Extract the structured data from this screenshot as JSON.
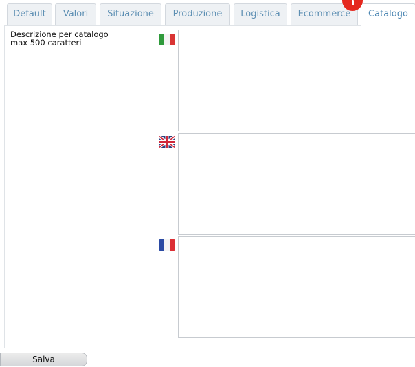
{
  "tabs": [
    {
      "label": "Default",
      "active": false
    },
    {
      "label": "Valori",
      "active": false
    },
    {
      "label": "Situazione",
      "active": false
    },
    {
      "label": "Produzione",
      "active": false
    },
    {
      "label": "Logistica",
      "active": false
    },
    {
      "label": "Ecommerce",
      "active": false
    },
    {
      "label": "Catalogo",
      "active": true
    }
  ],
  "notification_badge_color": "#e5281e",
  "catalog": {
    "description_line1": "Descrizione per catalogo",
    "description_line2": "max 500 caratteri",
    "languages": [
      {
        "flag_icon": "italy-flag-icon",
        "value": ""
      },
      {
        "flag_icon": "uk-flag-icon",
        "value": ""
      },
      {
        "flag_icon": "france-flag-icon",
        "value": ""
      }
    ]
  },
  "save_label": "Salva",
  "colors": {
    "tab_text": "#5d8fb3",
    "tab_bg": "#eef1f4",
    "border": "#c7cbd0"
  }
}
